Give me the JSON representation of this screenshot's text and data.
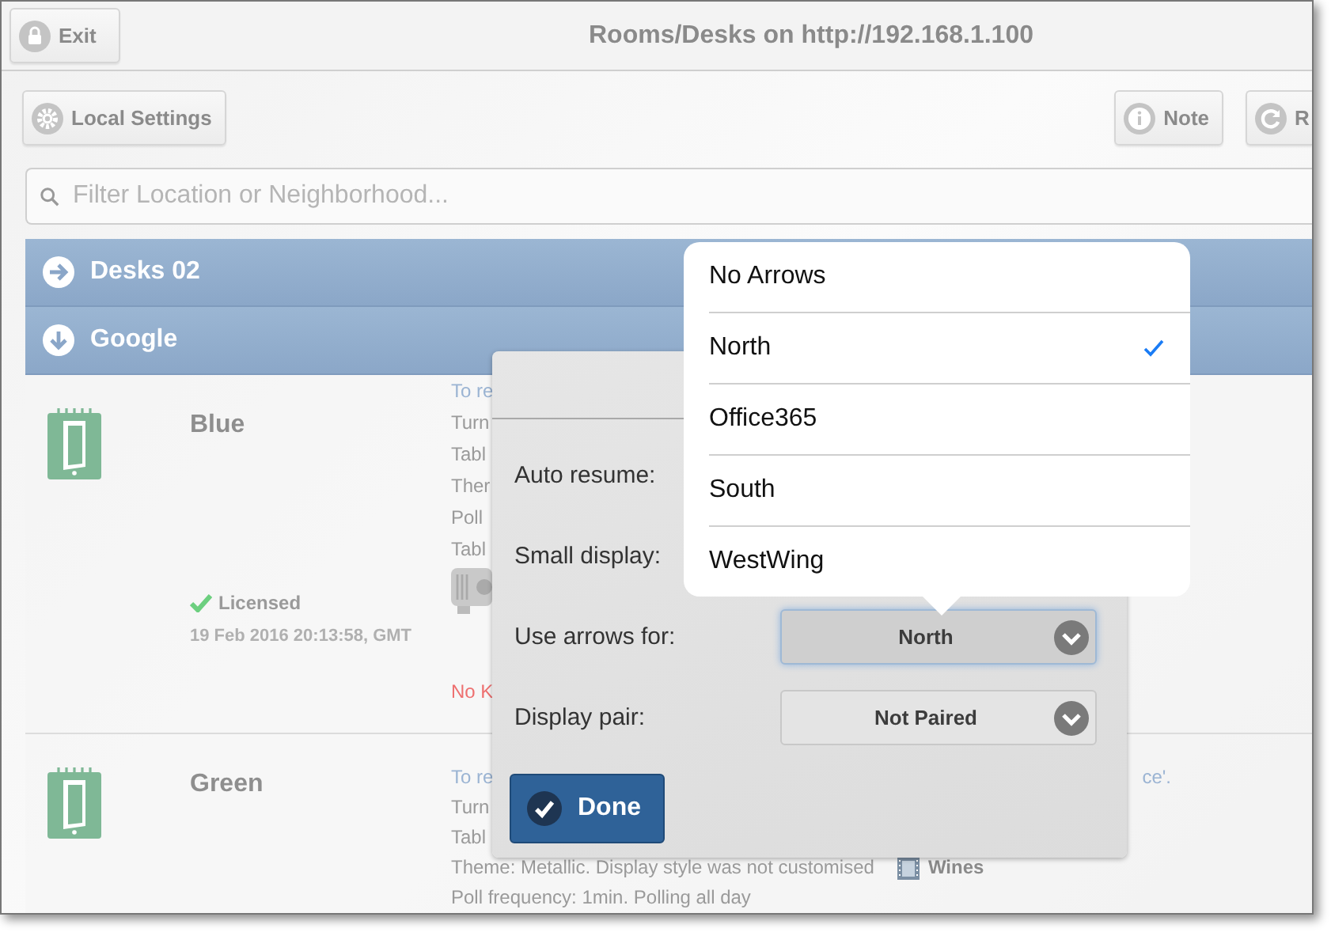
{
  "window": {
    "title": "Rooms/Desks on http://192.168.1.100",
    "exit_button": "Exit"
  },
  "toolbar": {
    "left": [
      {
        "label": "Local Settings"
      }
    ],
    "right": [
      {
        "label": "Note"
      },
      {
        "label": "R"
      }
    ]
  },
  "search": {
    "placeholder": "Filter Location or Neighborhood..."
  },
  "groups": [
    {
      "name": "Desks 02",
      "expanded": false
    },
    {
      "name": "Google",
      "expanded": true
    }
  ],
  "rows": [
    {
      "name": "Blue",
      "status": "Licensed",
      "timestamp": "19 Feb 2016 20:13:58, GMT",
      "trailing": "",
      "details": [
        {
          "kind": "link",
          "text": "To re"
        },
        {
          "kind": "text",
          "text": "Turn"
        },
        {
          "kind": "text",
          "text": "Tabl"
        },
        {
          "kind": "text",
          "text": "Ther"
        },
        {
          "kind": "text",
          "text": "Poll"
        },
        {
          "kind": "text",
          "text": "Tabl"
        },
        {
          "kind": "device"
        },
        {
          "kind": "warning",
          "text": "No K"
        }
      ]
    },
    {
      "name": "Green",
      "trailing": "ce'.",
      "details": [
        {
          "kind": "link",
          "text": "To re"
        },
        {
          "kind": "text",
          "text": "Turn"
        },
        {
          "kind": "text",
          "text": "Tabl"
        },
        {
          "kind": "text",
          "text": "Theme: Metallic. Display style was not customised",
          "badge": "Wines"
        },
        {
          "kind": "text",
          "text": "Poll frequency: 1min. Polling all day"
        }
      ]
    }
  ],
  "dialog": {
    "rows": [
      {
        "kind": "label",
        "label": "Auto resume:"
      },
      {
        "kind": "label",
        "label": "Small display:"
      },
      {
        "kind": "select",
        "label": "Use arrows for:",
        "value": "North",
        "focused": true
      },
      {
        "kind": "select",
        "label": "Display pair:",
        "value": "Not Paired",
        "focused": false
      }
    ],
    "done_button": "Done"
  },
  "popover": {
    "options": [
      {
        "label": "No Arrows",
        "selected": false
      },
      {
        "label": "North",
        "selected": true
      },
      {
        "label": "Office365",
        "selected": false
      },
      {
        "label": "South",
        "selected": false
      },
      {
        "label": "WestWing",
        "selected": false
      }
    ]
  }
}
